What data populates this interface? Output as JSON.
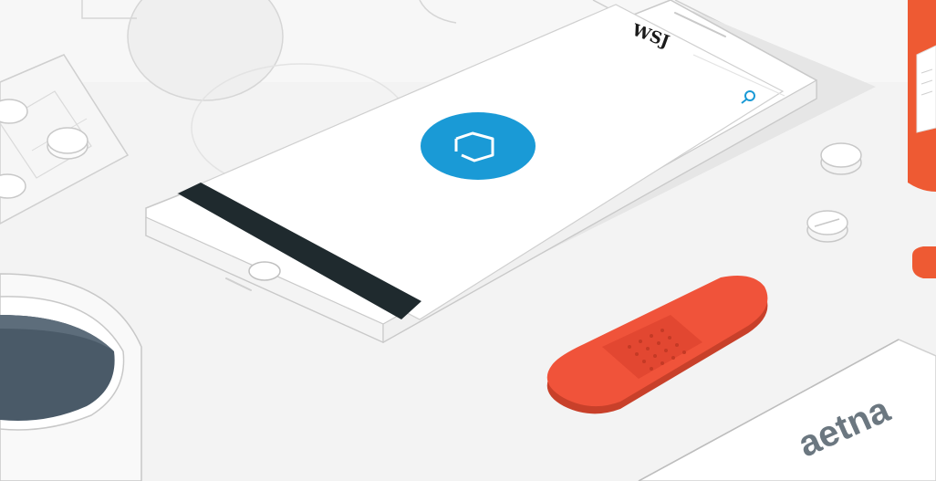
{
  "scene": {
    "phone_header_logo": "WSJ",
    "card_brand": "aetna",
    "icons": [
      "search-icon",
      "app-logo-icon"
    ]
  },
  "colors": {
    "background": "#f2f2f2",
    "app_icon_blue": "#1a9ad6",
    "bandage_red": "#f0533a",
    "bottle_orange": "#ee5a33",
    "screen_bar": "#1f2a2e",
    "mug_interior": "#4a5a68",
    "aetna_text": "#6b7780"
  }
}
